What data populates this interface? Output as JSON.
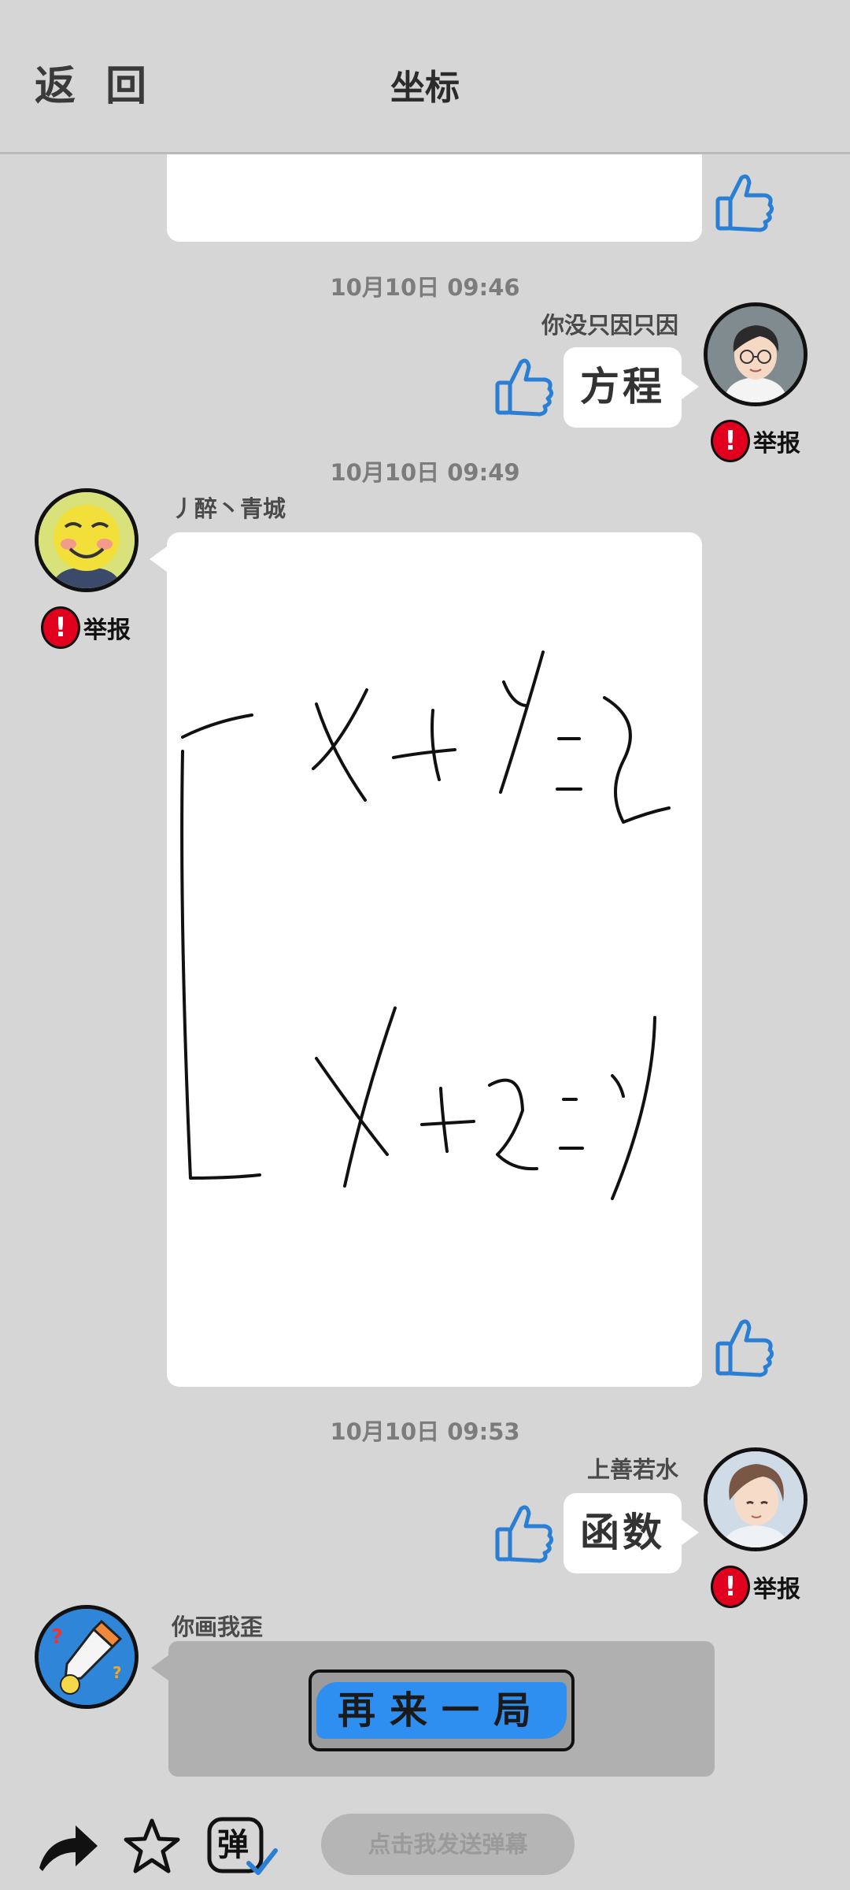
{
  "header": {
    "back_label": "返 回",
    "title": "坐标"
  },
  "messages": [
    {
      "time": "10月10日  09:46",
      "sender": "你没只因只因",
      "text": "方程",
      "report_label": "举报"
    },
    {
      "time": "10月10日  09:49",
      "sender": "丿醉丶青城",
      "report_label": "举报"
    },
    {
      "time": "10月10日  09:53",
      "sender": "上善若水",
      "text": "函数",
      "report_label": "举报"
    },
    {
      "sender": "你画我歪",
      "button_label": "再来一局"
    }
  ],
  "bottom": {
    "danmu_placeholder": "点击我发送弹幕",
    "danmu_icon_char": "弹"
  },
  "icons": [
    "back-icon",
    "thumb-up-icon",
    "report-icon",
    "share-icon",
    "star-icon",
    "danmu-icon"
  ],
  "colors": {
    "background": "#d6d6d6",
    "report_red": "#e1001e",
    "thumb_blue": "#2a7fd4",
    "button_blue": "#2f8ff0"
  }
}
